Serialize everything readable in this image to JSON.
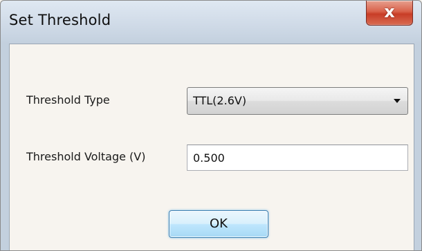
{
  "window": {
    "title": "Set Threshold",
    "close_label": "x"
  },
  "form": {
    "threshold_type_label": "Threshold Type",
    "threshold_type_value": "TTL(2.6V)",
    "threshold_voltage_label": "Threshold Voltage (V)",
    "threshold_voltage_value": "0.500"
  },
  "buttons": {
    "ok_label": "OK"
  },
  "icons": {
    "close": "close-icon",
    "dropdown": "chevron-down-icon"
  },
  "colors": {
    "titlebar": "#cfdae7",
    "close_button": "#d9614a",
    "ok_button_border": "#3c7fb1",
    "client_background": "#f7f4ef"
  }
}
